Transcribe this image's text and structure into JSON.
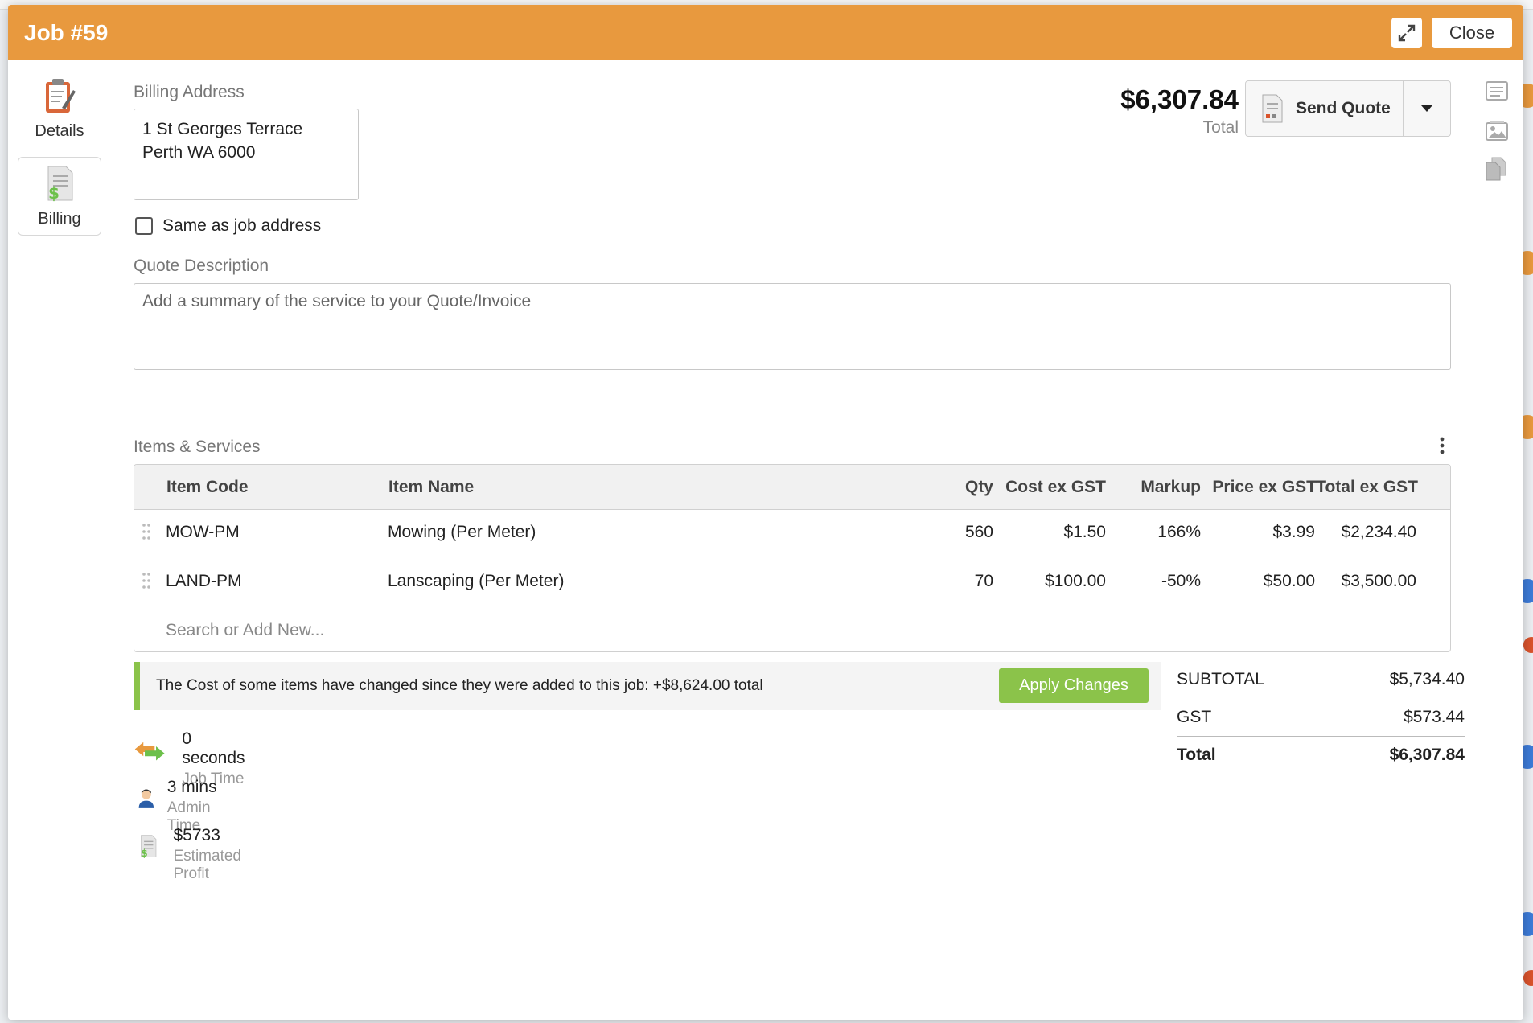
{
  "modal": {
    "title": "Job #59",
    "close_label": "Close"
  },
  "nav": {
    "items": [
      {
        "label": "Details",
        "icon": "clipboard-icon"
      },
      {
        "label": "Billing",
        "icon": "billing-document-icon"
      }
    ],
    "active": "Billing"
  },
  "billing": {
    "label": "Billing Address",
    "address_line1": "1 St Georges Terrace",
    "address_line2": "Perth WA 6000",
    "same_as_job_label": "Same as job address",
    "same_as_job_checked": false
  },
  "summary": {
    "total_amount": "$6,307.84",
    "total_caption": "Total",
    "send_quote_label": "Send Quote"
  },
  "quote": {
    "label": "Quote Description",
    "placeholder": "Add a summary of the service to your Quote/Invoice"
  },
  "items": {
    "label": "Items & Services",
    "columns": [
      "Item Code",
      "Item Name",
      "Qty",
      "Cost ex GST",
      "Markup",
      "Price ex GST",
      "Total ex GST"
    ],
    "rows": [
      {
        "code": "MOW-PM",
        "name": "Mowing (Per Meter)",
        "qty": "560",
        "cost": "$1.50",
        "markup": "166%",
        "price": "$3.99",
        "total": "$2,234.40"
      },
      {
        "code": "LAND-PM",
        "name": "Lanscaping (Per Meter)",
        "qty": "70",
        "cost": "$100.00",
        "markup": "-50%",
        "price": "$50.00",
        "total": "$3,500.00"
      }
    ],
    "search_placeholder": "Search or Add New..."
  },
  "notice": {
    "text": "The Cost of some items have changed since they were added to this job: +$8,624.00 total",
    "apply_label": "Apply Changes"
  },
  "totals": {
    "subtotal_label": "SUBTOTAL",
    "subtotal_value": "$5,734.40",
    "gst_label": "GST",
    "gst_value": "$573.44",
    "total_label": "Total",
    "total_value": "$6,307.84"
  },
  "stats": [
    {
      "value": "0 seconds",
      "caption": "Job Time",
      "icon": "arrows-icon"
    },
    {
      "value": "3 mins",
      "caption": "Admin Time",
      "icon": "person-icon"
    },
    {
      "value": "$5733",
      "caption": "Estimated Profit",
      "icon": "profit-document-icon"
    }
  ],
  "colors": {
    "header": "#e8993e",
    "accent_green": "#8bc34a"
  }
}
